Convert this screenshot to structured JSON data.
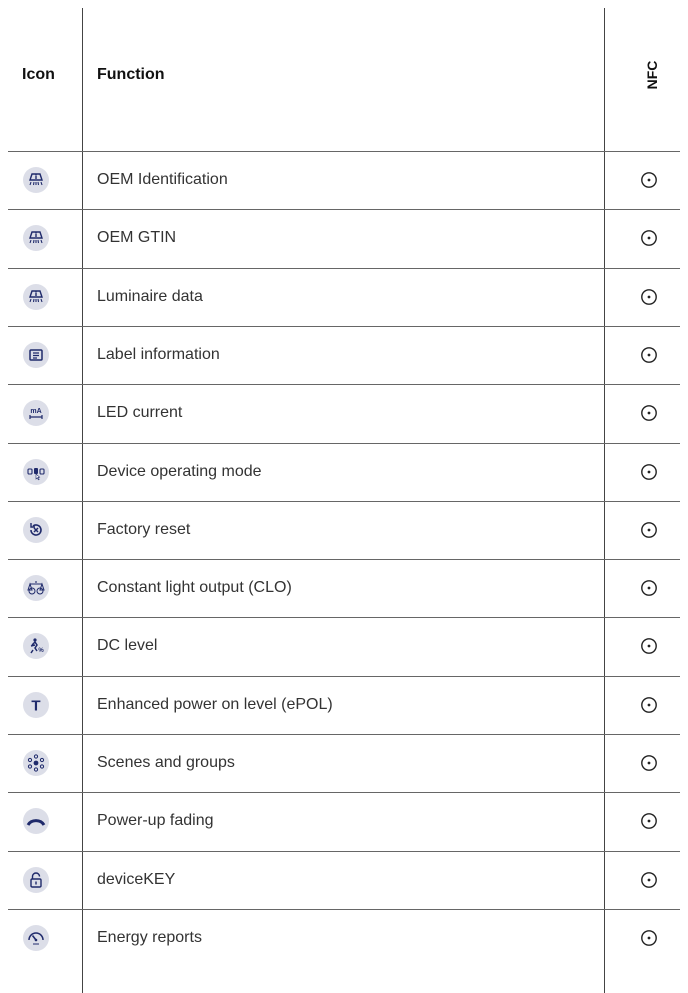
{
  "header": {
    "icon_col": "Icon",
    "function_col": "Function",
    "nfc_col": "NFC"
  },
  "rows": [
    {
      "icon": "oem-identification-icon",
      "label": "OEM Identification",
      "nfc": true
    },
    {
      "icon": "oem-gtin-icon",
      "label": "OEM GTIN",
      "nfc": true
    },
    {
      "icon": "luminaire-data-icon",
      "label": "Luminaire data",
      "nfc": true
    },
    {
      "icon": "label-information-icon",
      "label": "Label information",
      "nfc": true
    },
    {
      "icon": "led-current-icon",
      "label": "LED current",
      "nfc": true
    },
    {
      "icon": "device-operating-mode-icon",
      "label": "Device operating mode",
      "nfc": true
    },
    {
      "icon": "factory-reset-icon",
      "label": "Factory reset",
      "nfc": true
    },
    {
      "icon": "constant-light-output-icon",
      "label": "Constant light output (CLO)",
      "nfc": true
    },
    {
      "icon": "dc-level-icon",
      "label": "DC level",
      "nfc": true
    },
    {
      "icon": "enhanced-power-on-level-icon",
      "label": "Enhanced power on level (ePOL)",
      "nfc": true
    },
    {
      "icon": "scenes-and-groups-icon",
      "label": "Scenes and groups",
      "nfc": true
    },
    {
      "icon": "power-up-fading-icon",
      "label": "Power-up fading",
      "nfc": true
    },
    {
      "icon": "devicekey-icon",
      "label": "deviceKEY",
      "nfc": true
    },
    {
      "icon": "energy-reports-icon",
      "label": "Energy reports",
      "nfc": true
    }
  ],
  "colors": {
    "icon_bg": "#dcdee8",
    "icon_fg": "#1f2a6b",
    "grid": "#555555"
  }
}
